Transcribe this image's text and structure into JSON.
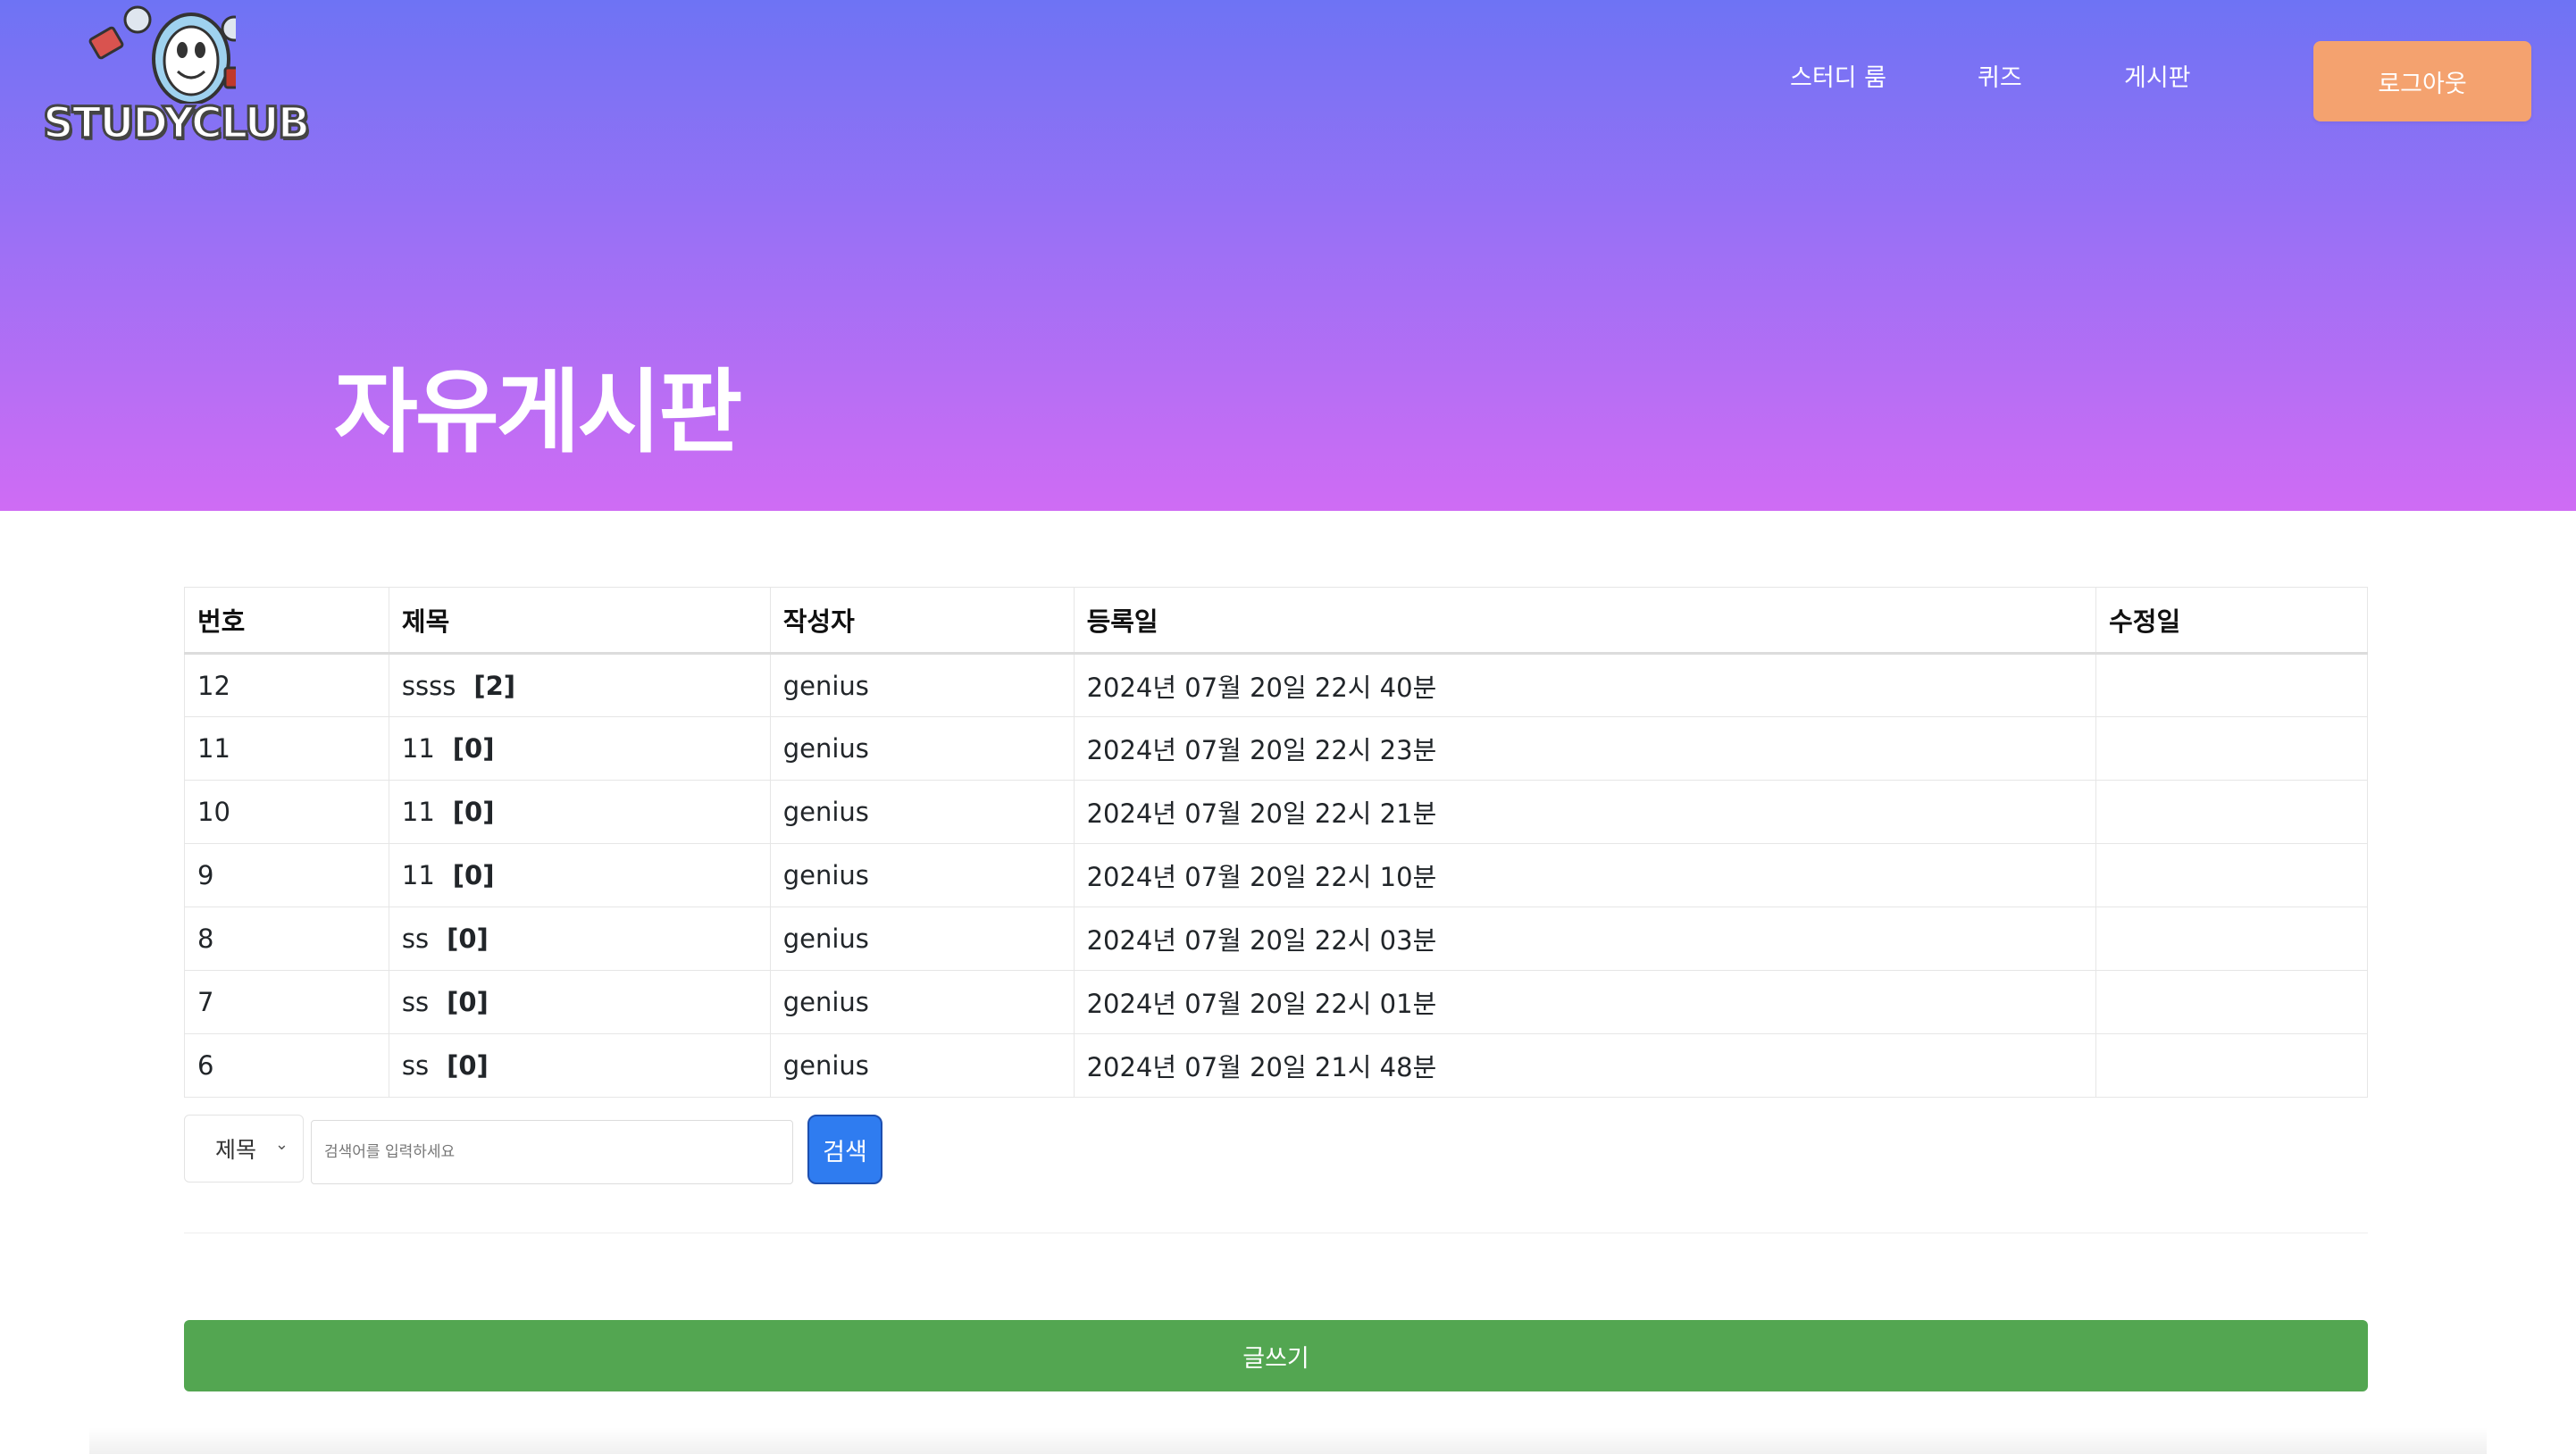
{
  "header": {
    "logo_text": "STUDYCLUB",
    "nav": {
      "study_room": "스터디 룸",
      "quiz": "퀴즈",
      "board": "게시판"
    },
    "logout_label": "로그아웃"
  },
  "hero": {
    "title": "자유게시판"
  },
  "table": {
    "columns": {
      "no": "번호",
      "title": "제목",
      "author": "작성자",
      "created": "등록일",
      "modified": "수정일"
    },
    "rows": [
      {
        "no": "12",
        "title": "ssss",
        "replies": "[2]",
        "author": "genius",
        "created": "2024년 07월 20일 22시 40분",
        "modified": ""
      },
      {
        "no": "11",
        "title": "11",
        "replies": "[0]",
        "author": "genius",
        "created": "2024년 07월 20일 22시 23분",
        "modified": ""
      },
      {
        "no": "10",
        "title": "11",
        "replies": "[0]",
        "author": "genius",
        "created": "2024년 07월 20일 22시 21분",
        "modified": ""
      },
      {
        "no": "9",
        "title": "11",
        "replies": "[0]",
        "author": "genius",
        "created": "2024년 07월 20일 22시 10분",
        "modified": ""
      },
      {
        "no": "8",
        "title": "ss",
        "replies": "[0]",
        "author": "genius",
        "created": "2024년 07월 20일 22시 03분",
        "modified": ""
      },
      {
        "no": "7",
        "title": "ss",
        "replies": "[0]",
        "author": "genius",
        "created": "2024년 07월 20일 22시 01분",
        "modified": ""
      },
      {
        "no": "6",
        "title": "ss",
        "replies": "[0]",
        "author": "genius",
        "created": "2024년 07월 20일 21시 48분",
        "modified": ""
      }
    ]
  },
  "search": {
    "field_selected": "제목",
    "input_value": "",
    "placeholder": "검색어를 입력하세요",
    "button_label": "검색"
  },
  "write_label": "글쓰기",
  "colors": {
    "hero_top": "#6e73f4",
    "hero_bottom": "#cf6cf4",
    "logout": "#f4a26f",
    "search_button": "#2f7cf0",
    "write_button": "#53a651"
  }
}
